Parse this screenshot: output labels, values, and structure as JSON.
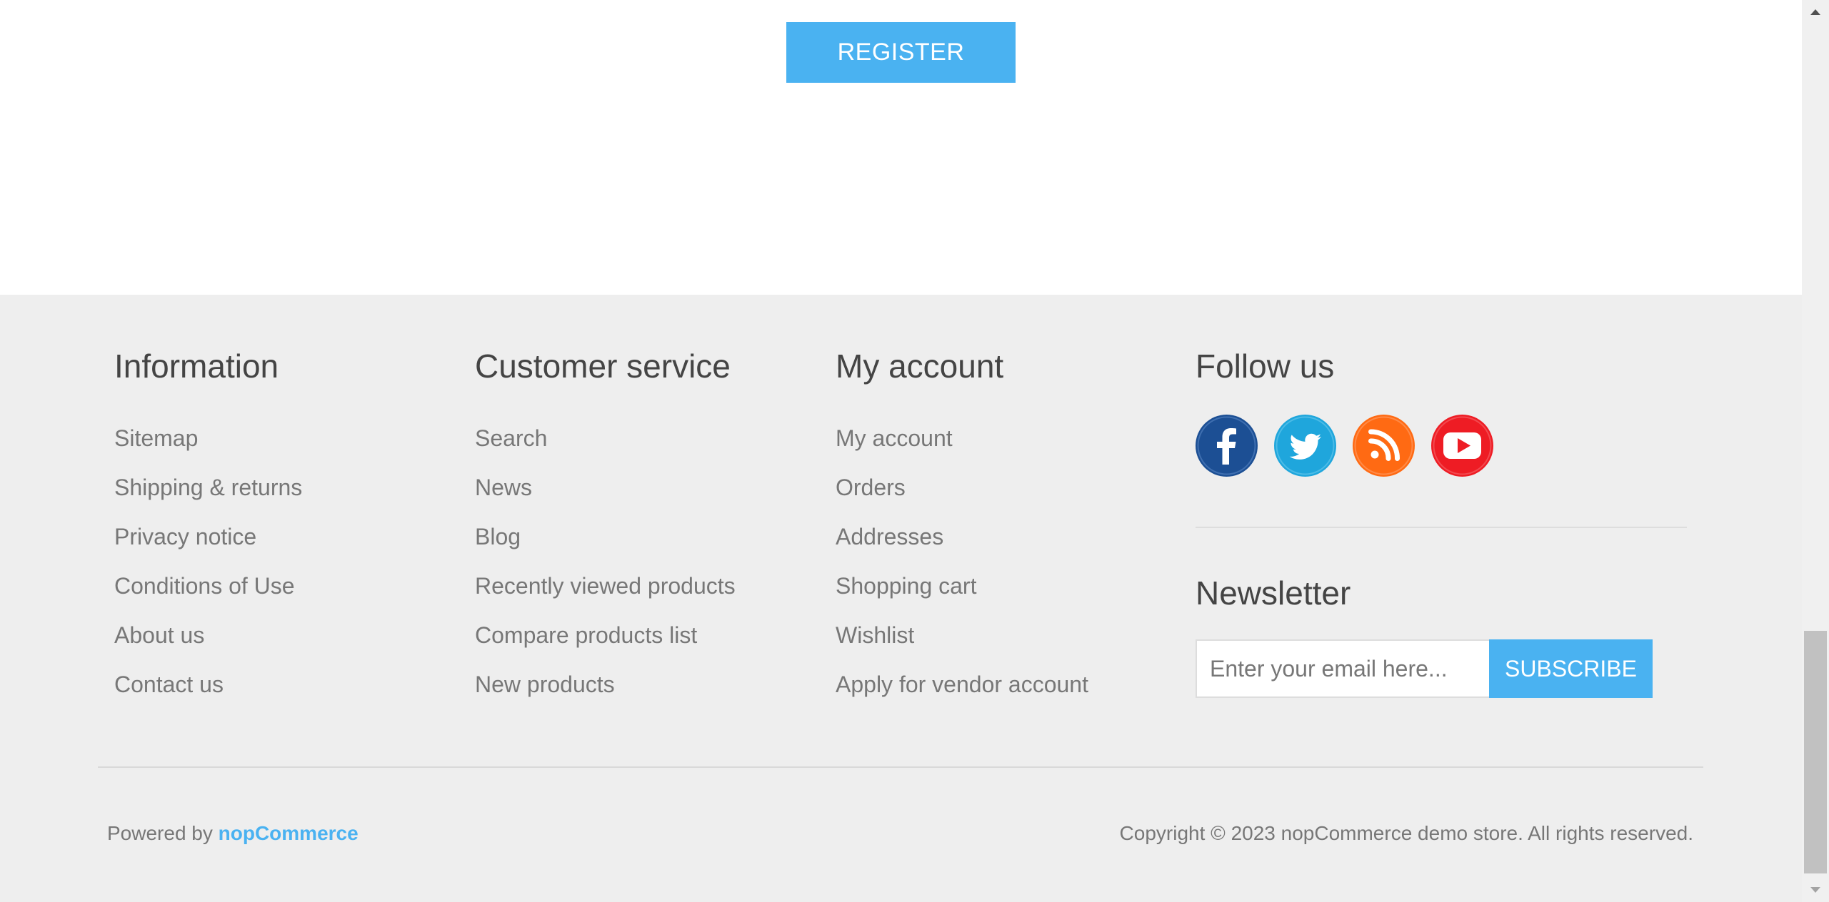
{
  "top": {
    "register_label": "REGISTER"
  },
  "footer": {
    "information": {
      "title": "Information",
      "items": [
        "Sitemap",
        "Shipping & returns",
        "Privacy notice",
        "Conditions of Use",
        "About us",
        "Contact us"
      ]
    },
    "customer_service": {
      "title": "Customer service",
      "items": [
        "Search",
        "News",
        "Blog",
        "Recently viewed products",
        "Compare products list",
        "New products"
      ]
    },
    "my_account": {
      "title": "My account",
      "items": [
        "My account",
        "Orders",
        "Addresses",
        "Shopping cart",
        "Wishlist",
        "Apply for vendor account"
      ]
    },
    "follow_us": {
      "title": "Follow us",
      "icons": [
        {
          "name": "facebook-icon",
          "color": "#1c4f94"
        },
        {
          "name": "twitter-icon",
          "color": "#1fa6dc"
        },
        {
          "name": "rss-icon",
          "color": "#ff6a13"
        },
        {
          "name": "youtube-icon",
          "color": "#ee1c24"
        }
      ]
    },
    "newsletter": {
      "title": "Newsletter",
      "placeholder": "Enter your email here...",
      "subscribe_label": "SUBSCRIBE"
    },
    "powered_by": {
      "prefix": "Powered by ",
      "link": "nopCommerce"
    },
    "copyright": "Copyright © 2023 nopCommerce demo store. All rights reserved."
  },
  "colors": {
    "accent": "#4ab2f1",
    "footer_bg": "#eeeeee",
    "heading": "#444444",
    "link": "#777777"
  }
}
